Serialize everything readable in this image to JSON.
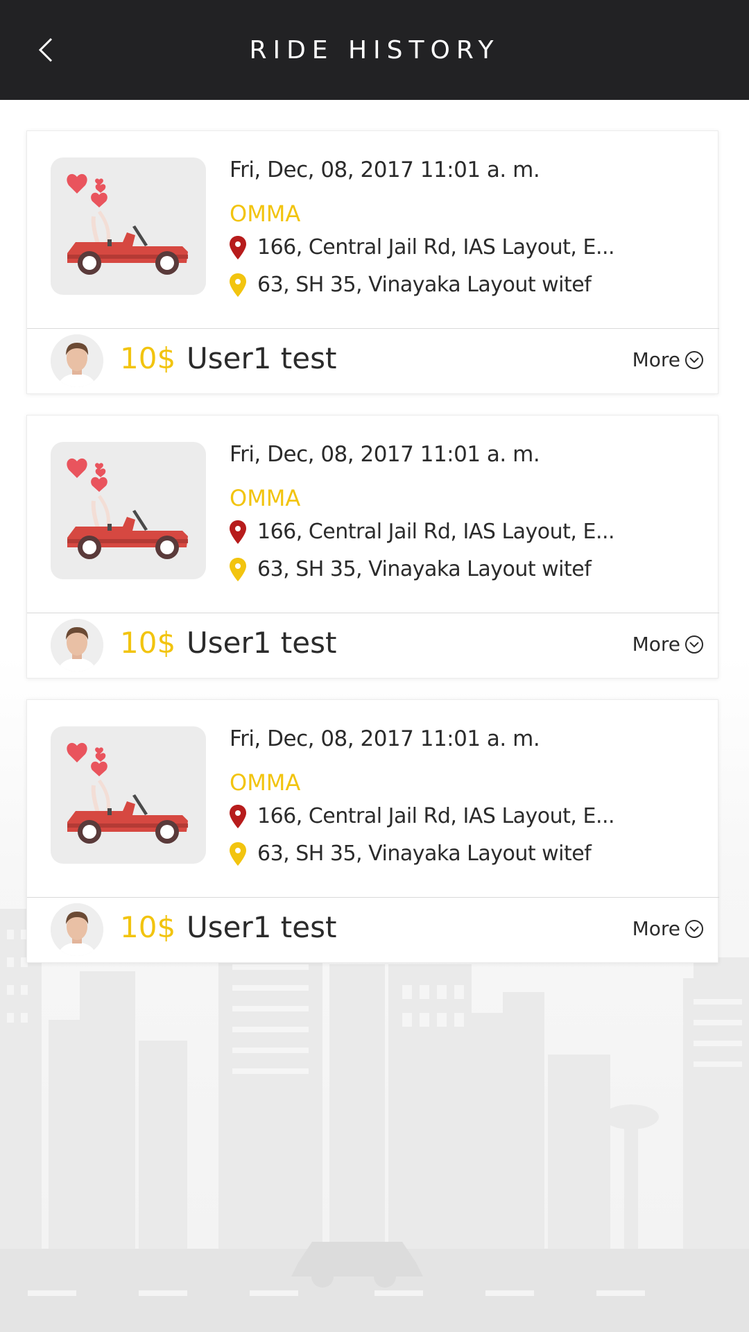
{
  "header": {
    "title": "RIDE HISTORY",
    "back_icon": "chevron-left-icon"
  },
  "colors": {
    "header_bg": "#222224",
    "accent_yellow": "#f2c40f",
    "pickup_pin": "#b71c1c",
    "drop_pin": "#f2c40f"
  },
  "rides": [
    {
      "date": "Fri, Dec, 08, 2017 11:01 a. m.",
      "driver": "OMMA",
      "pickup": "166, Central Jail Rd, IAS Layout, E...",
      "drop": "63, SH 35, Vinayaka Layout witef",
      "price": "10$",
      "user": "User1 test",
      "more_label": "More"
    },
    {
      "date": "Fri, Dec, 08, 2017 11:01 a. m.",
      "driver": "OMMA",
      "pickup": "166, Central Jail Rd, IAS Layout, E...",
      "drop": "63, SH 35, Vinayaka Layout witef",
      "price": "10$",
      "user": "User1 test",
      "more_label": "More"
    },
    {
      "date": "Fri, Dec, 08, 2017 11:01 a. m.",
      "driver": "OMMA",
      "pickup": "166, Central Jail Rd, IAS Layout, E...",
      "drop": "63, SH 35, Vinayaka Layout witef",
      "price": "10$",
      "user": "User1 test",
      "more_label": "More"
    }
  ]
}
